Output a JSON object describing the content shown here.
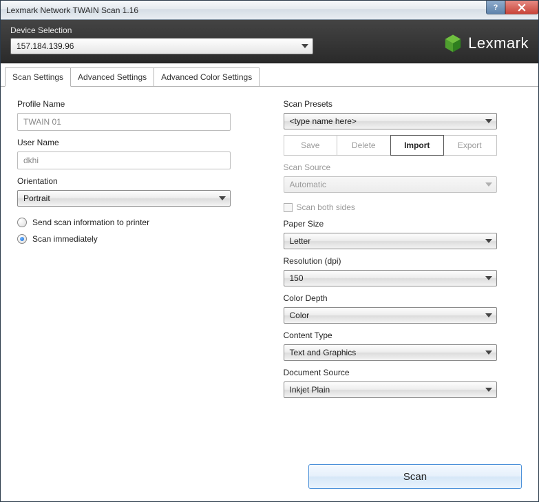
{
  "window": {
    "title": "Lexmark Network TWAIN Scan  1.16"
  },
  "brand": "Lexmark",
  "device": {
    "label": "Device Selection",
    "value": "157.184.139.96"
  },
  "tabs": [
    {
      "label": "Scan Settings"
    },
    {
      "label": "Advanced Settings"
    },
    {
      "label": "Advanced Color Settings"
    }
  ],
  "left": {
    "profile_name_label": "Profile Name",
    "profile_name_value": "TWAIN 01",
    "user_name_label": "User Name",
    "user_name_value": "dkhi",
    "orientation_label": "Orientation",
    "orientation_value": "Portrait",
    "radio_send_label": "Send scan information to printer",
    "radio_scan_label": "Scan immediately"
  },
  "right": {
    "presets_label": "Scan Presets",
    "presets_value": "<type name here>",
    "presets_buttons": {
      "save": "Save",
      "delete": "Delete",
      "import": "Import",
      "export": "Export"
    },
    "source_label": "Scan Source",
    "source_value": "Automatic",
    "both_sides_label": "Scan both sides",
    "paper_label": "Paper Size",
    "paper_value": "Letter",
    "resolution_label": "Resolution (dpi)",
    "resolution_value": "150",
    "depth_label": "Color Depth",
    "depth_value": "Color",
    "content_label": "Content Type",
    "content_value": "Text and Graphics",
    "docsource_label": "Document Source",
    "docsource_value": "Inkjet Plain"
  },
  "footer": {
    "scan": "Scan"
  }
}
